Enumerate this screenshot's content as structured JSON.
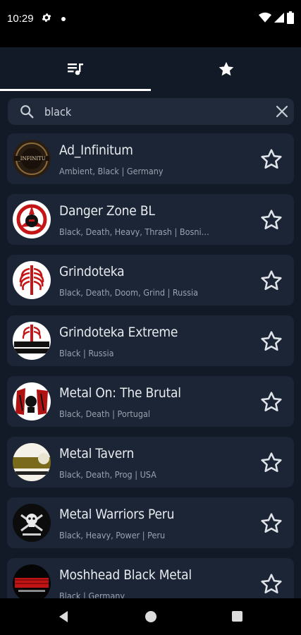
{
  "status_bar": {
    "time": "10:29",
    "icons": [
      "gear-icon",
      "dot-icon",
      "wifi-icon",
      "signal-icon",
      "battery-icon"
    ]
  },
  "tabs": [
    {
      "name": "playlists",
      "icon": "queue-music-icon",
      "selected": true
    },
    {
      "name": "favorites",
      "icon": "star-icon",
      "selected": false
    }
  ],
  "search": {
    "value": "black",
    "icon": "search-icon",
    "clear_icon": "close-icon"
  },
  "stations": [
    {
      "name": "Ad_Infinitum",
      "meta": "Ambient, Black | Germany"
    },
    {
      "name": "Danger Zone BL",
      "meta": "Black, Death, Heavy, Thrash | Bosnia-..."
    },
    {
      "name": "Grindoteka",
      "meta": "Black, Death, Doom, Grind | Russia"
    },
    {
      "name": "Grindoteka Extreme",
      "meta": "Black | Russia"
    },
    {
      "name": "Metal On: The Brutal",
      "meta": "Black, Death | Portugal"
    },
    {
      "name": "Metal Tavern",
      "meta": "Black, Death, Prog | USA"
    },
    {
      "name": "Metal Warriors Peru",
      "meta": "Black, Heavy, Power | Peru"
    },
    {
      "name": "Moshhead Black Metal",
      "meta": "Black | Germany"
    }
  ],
  "colors": {
    "background": "#121a27",
    "card": "#1c2536",
    "search_bg": "#202a3b",
    "text_primary": "#e8ebef",
    "text_secondary": "#98a1ae"
  },
  "nav_bar": {
    "icons": [
      "back-icon",
      "home-icon",
      "recents-icon"
    ]
  }
}
